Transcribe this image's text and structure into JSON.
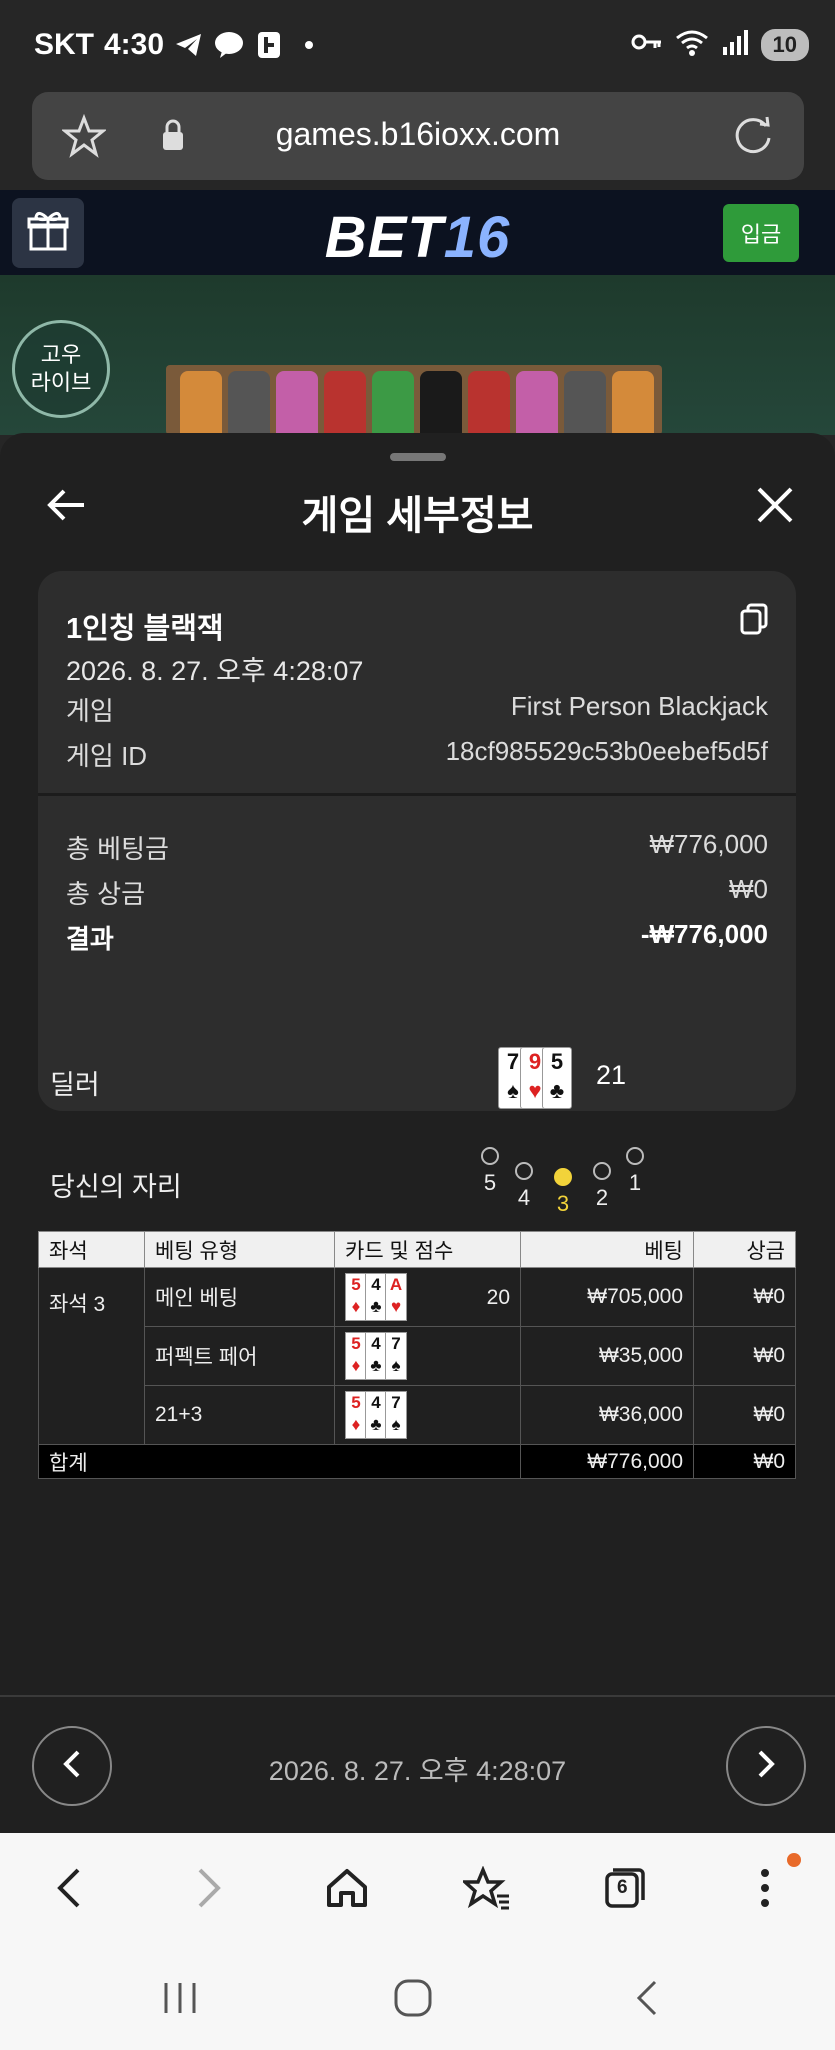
{
  "status_bar": {
    "carrier": "SKT",
    "time": "4:30",
    "battery": "10"
  },
  "url_bar": {
    "url": "games.b16ioxx.com"
  },
  "site_header": {
    "logo_part1": "BET",
    "logo_part2": "16",
    "deposit_label": "입금"
  },
  "live_badge": {
    "line1": "고우",
    "line2": "라이브"
  },
  "modal": {
    "title": "게임 세부정보",
    "game_name": "1인칭 블랙잭",
    "datetime": "2026. 8. 27. 오후 4:28:07",
    "rows": [
      {
        "label": "게임",
        "value": "First Person Blackjack"
      },
      {
        "label": "게임 ID",
        "value": "18cf985529c53b0eebef5d5f"
      }
    ],
    "summary": [
      {
        "label": "총 베팅금",
        "value": "₩776,000"
      },
      {
        "label": "총 상금",
        "value": "₩0"
      },
      {
        "label": "결과",
        "value": "-₩776,000"
      }
    ],
    "dealer_label": "딜러",
    "dealer_cards": [
      {
        "rank": "7",
        "suit": "♠",
        "color": "black"
      },
      {
        "rank": "9",
        "suit": "♥",
        "color": "red"
      },
      {
        "rank": "5",
        "suit": "♣",
        "color": "black"
      }
    ],
    "dealer_score": "21",
    "seat_label": "당신의 자리",
    "seats": [
      "5",
      "4",
      "3",
      "2",
      "1"
    ],
    "active_seat": "3",
    "table": {
      "headers": [
        "좌석",
        "베팅 유형",
        "카드 및 점수",
        "베팅",
        "상금"
      ],
      "seat": "좌석 3",
      "rows": [
        {
          "type": "메인 베팅",
          "cards": [
            {
              "rank": "5",
              "suit": "♦",
              "color": "red"
            },
            {
              "rank": "4",
              "suit": "♣",
              "color": "black"
            },
            {
              "rank": "A",
              "suit": "♥",
              "color": "red"
            }
          ],
          "score": "20",
          "bet": "₩705,000",
          "win": "₩0"
        },
        {
          "type": "퍼펙트 페어",
          "cards": [
            {
              "rank": "5",
              "suit": "♦",
              "color": "red"
            },
            {
              "rank": "4",
              "suit": "♣",
              "color": "black"
            },
            {
              "rank": "7",
              "suit": "♠",
              "color": "black"
            }
          ],
          "score": "",
          "bet": "₩35,000",
          "win": "₩0"
        },
        {
          "type": "21+3",
          "cards": [
            {
              "rank": "5",
              "suit": "♦",
              "color": "red"
            },
            {
              "rank": "4",
              "suit": "♣",
              "color": "black"
            },
            {
              "rank": "7",
              "suit": "♠",
              "color": "black"
            }
          ],
          "score": "",
          "bet": "₩36,000",
          "win": "₩0"
        }
      ],
      "total_label": "합계",
      "total_bet": "₩776,000",
      "total_win": "₩0"
    },
    "footer_datetime": "2026. 8. 27. 오후 4:28:07"
  },
  "browser_toolbar": {
    "tabs_count": "6"
  },
  "colors": {
    "accent_green": "#2f9b3a",
    "logo_blue": "#8bb3ff",
    "seat_active": "#f2d33a"
  }
}
